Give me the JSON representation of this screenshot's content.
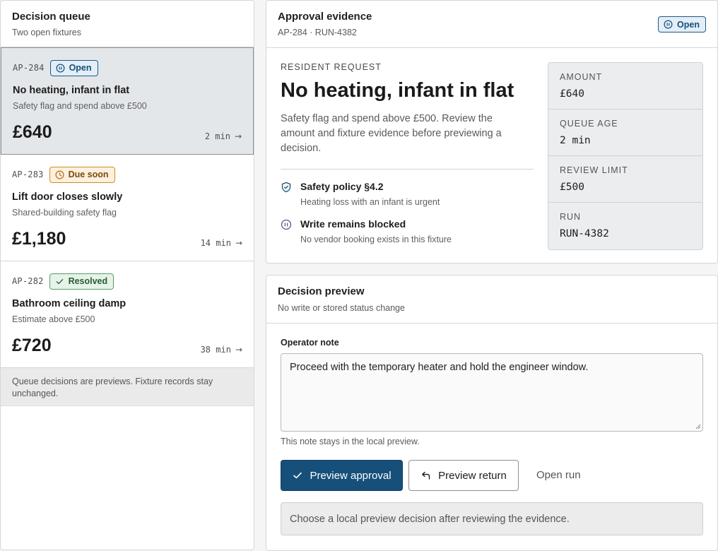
{
  "queue": {
    "title": "Decision queue",
    "subtitle": "Two open fixtures",
    "items": [
      {
        "id": "AP-284",
        "status": "Open",
        "title": "No heating, infant in flat",
        "subtitle": "Safety flag and spend above £500",
        "amount": "£640",
        "age": "2 min",
        "selected": true
      },
      {
        "id": "AP-283",
        "status": "Due soon",
        "title": "Lift door closes slowly",
        "subtitle": "Shared-building safety flag",
        "amount": "£1,180",
        "age": "14 min"
      },
      {
        "id": "AP-282",
        "status": "Resolved",
        "title": "Bathroom ceiling damp",
        "subtitle": "Estimate above £500",
        "amount": "£720",
        "age": "38 min"
      }
    ],
    "footer_note": "Queue decisions are previews. Fixture records stay unchanged."
  },
  "evidence": {
    "title": "Approval evidence",
    "subtitle": "AP-284 · RUN-4382",
    "status": "Open",
    "kicker": "RESIDENT REQUEST",
    "heading": "No heating, infant in flat",
    "description": "Safety flag and spend above £500. Review the amount and fixture evidence before previewing a decision.",
    "items": [
      {
        "title": "Safety policy §4.2",
        "detail": "Heating loss with an infant is urgent",
        "icon": "shield-check-icon"
      },
      {
        "title": "Write remains blocked",
        "detail": "No vendor booking exists in this fixture",
        "icon": "pause-circle-icon"
      }
    ],
    "facts": [
      {
        "label": "AMOUNT",
        "value": "£640"
      },
      {
        "label": "QUEUE AGE",
        "value": "2 min"
      },
      {
        "label": "REVIEW LIMIT",
        "value": "£500"
      },
      {
        "label": "RUN",
        "value": "RUN-4382"
      }
    ]
  },
  "decision": {
    "title": "Decision preview",
    "subtitle": "No write or stored status change",
    "note_label": "Operator note",
    "note_value": "Proceed with the temporary heater and hold the engineer window.",
    "hint": "This note stays in the local preview.",
    "approve_label": "Preview approval",
    "return_label": "Preview return",
    "open_run_label": "Open run",
    "status_text": "Choose a local preview decision after reviewing the evidence."
  },
  "colors": {
    "accent": "#16507a",
    "open": "#1e5a85",
    "due": "#d08a2a",
    "resolved": "#5a9b66"
  }
}
